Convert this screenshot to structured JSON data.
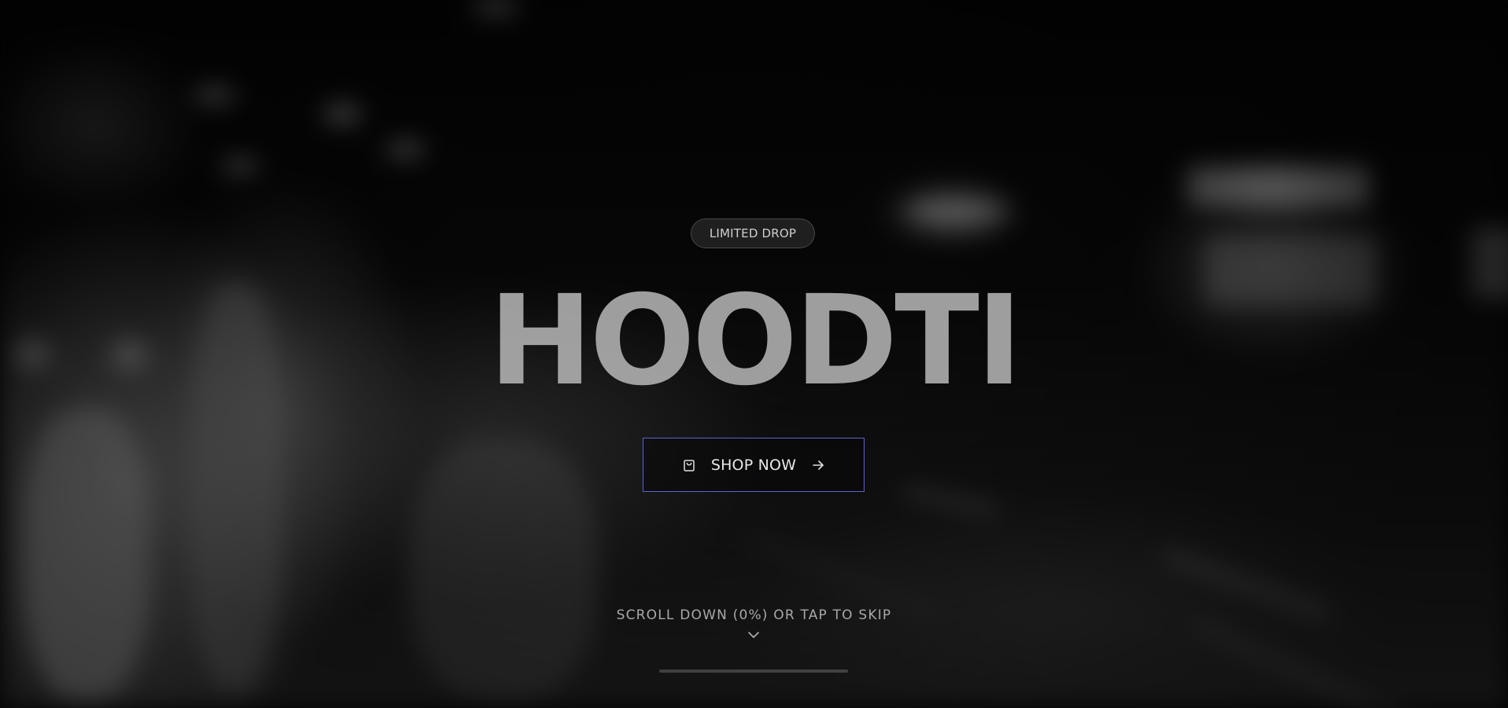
{
  "hero": {
    "badge": "LIMITED DROP",
    "title": "HOODTI",
    "cta": {
      "label": "SHOP NOW",
      "leading_icon": "shopping-bag-icon",
      "trailing_icon": "arrow-right-icon",
      "border_color": "#5d63c9"
    },
    "scroll_hint": "SCROLL DOWN (0%) OR TAP TO SKIP",
    "scroll_icon": "chevron-down-icon",
    "scroll_progress": 0
  },
  "colors": {
    "background": "#060606",
    "title": "#b9b9b9",
    "accent": "#5d63c9"
  }
}
